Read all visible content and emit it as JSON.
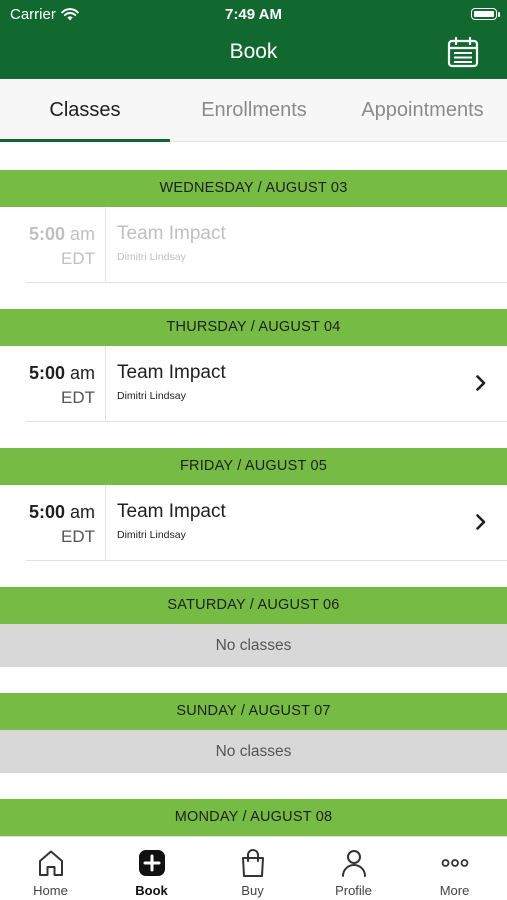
{
  "status_bar": {
    "carrier": "Carrier",
    "time": "7:49 AM"
  },
  "header": {
    "title": "Book",
    "calendar_icon": "calendar-icon"
  },
  "tabs": [
    {
      "label": "Classes",
      "active": true
    },
    {
      "label": "Enrollments",
      "active": false
    },
    {
      "label": "Appointments",
      "active": false
    }
  ],
  "days": [
    {
      "header": "WEDNESDAY / AUGUST 03",
      "classes": [
        {
          "time": "5:00",
          "ampm": "am",
          "tz": "EDT",
          "name": "Team Impact",
          "instructor": "Dimitri Lindsay",
          "past": true
        }
      ]
    },
    {
      "header": "THURSDAY / AUGUST 04",
      "classes": [
        {
          "time": "5:00",
          "ampm": "am",
          "tz": "EDT",
          "name": "Team Impact",
          "instructor": "Dimitri Lindsay",
          "past": false
        }
      ]
    },
    {
      "header": "FRIDAY / AUGUST 05",
      "classes": [
        {
          "time": "5:00",
          "ampm": "am",
          "tz": "EDT",
          "name": "Team Impact",
          "instructor": "Dimitri Lindsay",
          "past": false
        }
      ]
    },
    {
      "header": "SATURDAY / AUGUST 06",
      "empty_text": "No classes"
    },
    {
      "header": "SUNDAY / AUGUST 07",
      "empty_text": "No classes"
    },
    {
      "header": "MONDAY / AUGUST 08"
    }
  ],
  "bottom_nav": [
    {
      "label": "Home",
      "icon": "home-icon",
      "active": false
    },
    {
      "label": "Book",
      "icon": "book-plus-icon",
      "active": true
    },
    {
      "label": "Buy",
      "icon": "shopping-bag-icon",
      "active": false
    },
    {
      "label": "Profile",
      "icon": "profile-icon",
      "active": false
    },
    {
      "label": "More",
      "icon": "more-icon",
      "active": false
    }
  ],
  "colors": {
    "header_bg": "#11692f",
    "day_header_bg": "#75bb44",
    "no_classes_bg": "#d8d8d8"
  }
}
